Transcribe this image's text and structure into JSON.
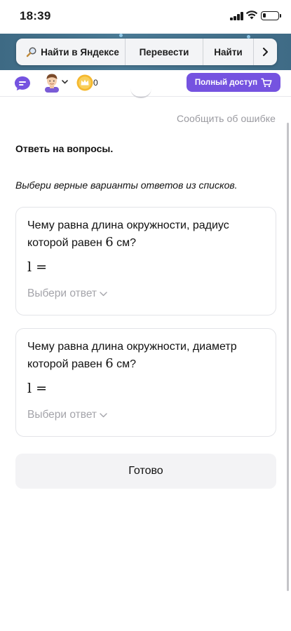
{
  "status_bar": {
    "time": "18:39",
    "battery_level": 0.2
  },
  "browser": {
    "search_label": "Найти в Яндексе",
    "translate_label": "Перевести",
    "find_label": "Найти"
  },
  "header": {
    "coin_count": "0",
    "access_button_label": "Полный доступ",
    "brand_color": "#7553e0"
  },
  "content": {
    "report_link": "Сообщить об ошибке",
    "task_title": "Ответь на вопросы.",
    "instruction": "Выбери верные варианты ответов из списков.",
    "questions": [
      {
        "text_before": "Чему равна длина окружности, радиус которой равен",
        "number": "6",
        "text_after": "см?",
        "formula": "l =",
        "select_placeholder": "Выбери ответ"
      },
      {
        "text_before": "Чему равна длина окружности, диаметр которой равен",
        "number": "6",
        "text_after": "см?",
        "formula": "l =",
        "select_placeholder": "Выбери ответ"
      }
    ],
    "done_button_label": "Готово"
  }
}
